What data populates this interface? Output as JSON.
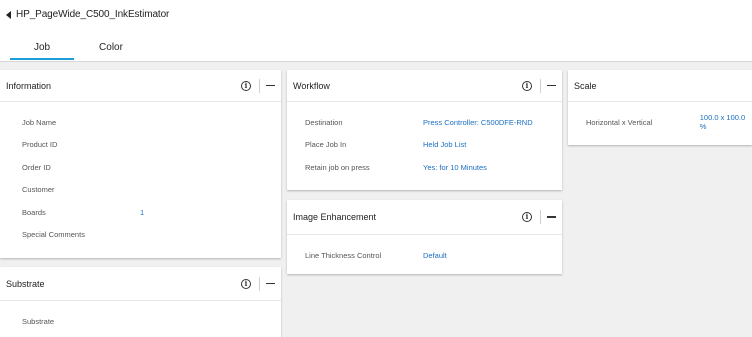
{
  "header": {
    "back_title": "HP_PageWide_C500_InkEstimator",
    "tabs": [
      {
        "label": "Job",
        "active": true
      },
      {
        "label": "Color",
        "active": false
      }
    ]
  },
  "accent_color": "#1a9fd6",
  "link_color": "#1c6fc1",
  "panels": {
    "information": {
      "title": "Information",
      "rows": [
        {
          "label": "Job Name",
          "value": ""
        },
        {
          "label": "Product ID",
          "value": ""
        },
        {
          "label": "Order ID",
          "value": ""
        },
        {
          "label": "Customer",
          "value": ""
        },
        {
          "label": "Boards",
          "value": "1"
        },
        {
          "label": "Special Comments",
          "value": ""
        }
      ]
    },
    "substrate": {
      "title": "Substrate",
      "rows": [
        {
          "label": "Substrate",
          "value": ""
        }
      ]
    },
    "workflow": {
      "title": "Workflow",
      "rows": [
        {
          "label": "Destination",
          "value": "Press Controller: C500DFE-RND"
        },
        {
          "label": "Place Job In",
          "value": "Held Job List"
        },
        {
          "label": "Retain job on press",
          "value": "Yes: for 10 Minutes"
        }
      ]
    },
    "image_enhancement": {
      "title": "Image Enhancement",
      "rows": [
        {
          "label": "Line Thickness Control",
          "value": "Default"
        }
      ]
    },
    "scale": {
      "title": "Scale",
      "rows": [
        {
          "label": "Horizontal x Vertical",
          "value": "100.0 x 100.0 %"
        }
      ]
    }
  },
  "icons": {
    "info": "info-circle-icon",
    "collapse": "minus-icon",
    "back": "chevron-left-icon"
  }
}
